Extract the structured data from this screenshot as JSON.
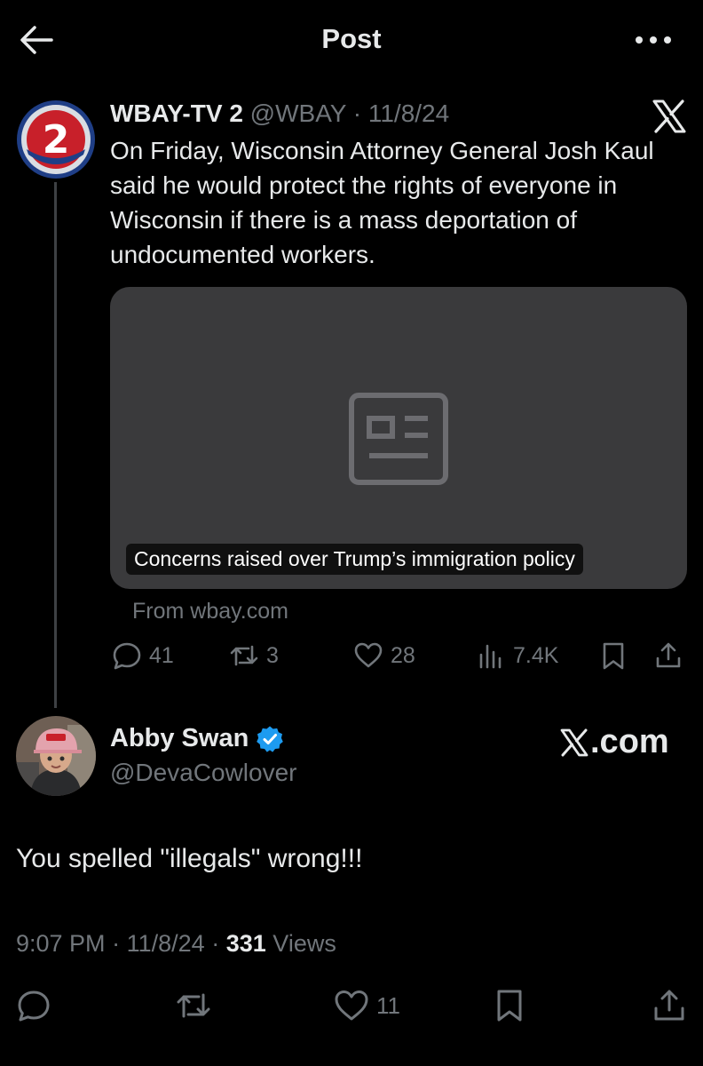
{
  "header": {
    "title": "Post"
  },
  "quoted_post": {
    "name": "WBAY-TV 2",
    "handle": "@WBAY",
    "separator": "·",
    "date": "11/8/24",
    "text": "On Friday, Wisconsin Attorney General Josh Kaul said he would protect the rights of everyone in Wisconsin if there is a mass deportation of undocumented workers.",
    "card": {
      "label": "Concerns raised over Trump’s immigration policy",
      "from": "From wbay.com"
    },
    "stats": {
      "replies": "41",
      "reposts": "3",
      "likes": "28",
      "views": "7.4K"
    }
  },
  "reply": {
    "name": "Abby Swan",
    "handle": "@DevaCowlover",
    "watermark": ".com",
    "text": "You spelled \"illegals\" wrong!!!",
    "time": "9:07 PM",
    "date": "11/8/24",
    "view_count": "331",
    "views_label": "Views",
    "likes": "11"
  },
  "colors": {
    "background": "#000000",
    "text": "#e7e9ea",
    "muted": "#71767b",
    "verified": "#1d9bf0",
    "card": "#3a3a3c"
  },
  "icons": [
    "back-arrow-icon",
    "more-icon",
    "x-logo-icon",
    "news-article-icon",
    "reply-icon",
    "repost-icon",
    "like-icon",
    "views-icon",
    "bookmark-icon",
    "share-icon",
    "verified-icon"
  ]
}
